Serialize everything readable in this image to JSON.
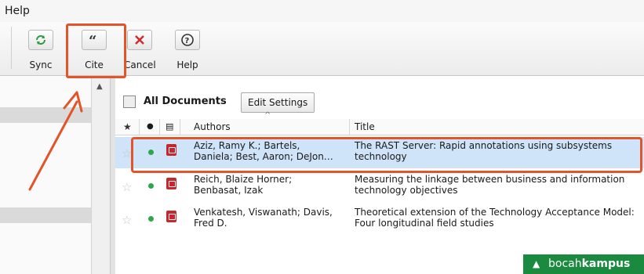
{
  "menubar": {
    "help": "Help"
  },
  "toolbar": {
    "sync": "Sync",
    "cite": "Cite",
    "cancel": "Cancel",
    "help": "Help"
  },
  "main": {
    "title": "All Documents",
    "edit_settings": "Edit Settings",
    "columns": {
      "authors": "Authors",
      "title": "Title"
    },
    "rows": [
      {
        "authors": "Aziz, Ramy K.; Bartels, Daniela; Best, Aaron; DeJon…",
        "title": "The RAST Server: Rapid annotations using subsystems technology",
        "selected": true
      },
      {
        "authors": "Reich, Blaize Horner; Benbasat, Izak",
        "title": "Measuring the linkage between business and information technology objectives",
        "selected": false
      },
      {
        "authors": "Venkatesh, Viswanath; Davis, Fred D.",
        "title": "Theoretical extension of the Technology Acceptance Model: Four longitudinal field studies",
        "selected": false
      }
    ]
  },
  "watermark": {
    "part1": "bocah",
    "part2": "kampus"
  },
  "colors": {
    "annotation": "#e2552b",
    "selected_row": "#cfe4f9",
    "read_dot": "#2aa84a",
    "pdf": "#c8262c",
    "watermark_bg": "#1a8a3f"
  }
}
